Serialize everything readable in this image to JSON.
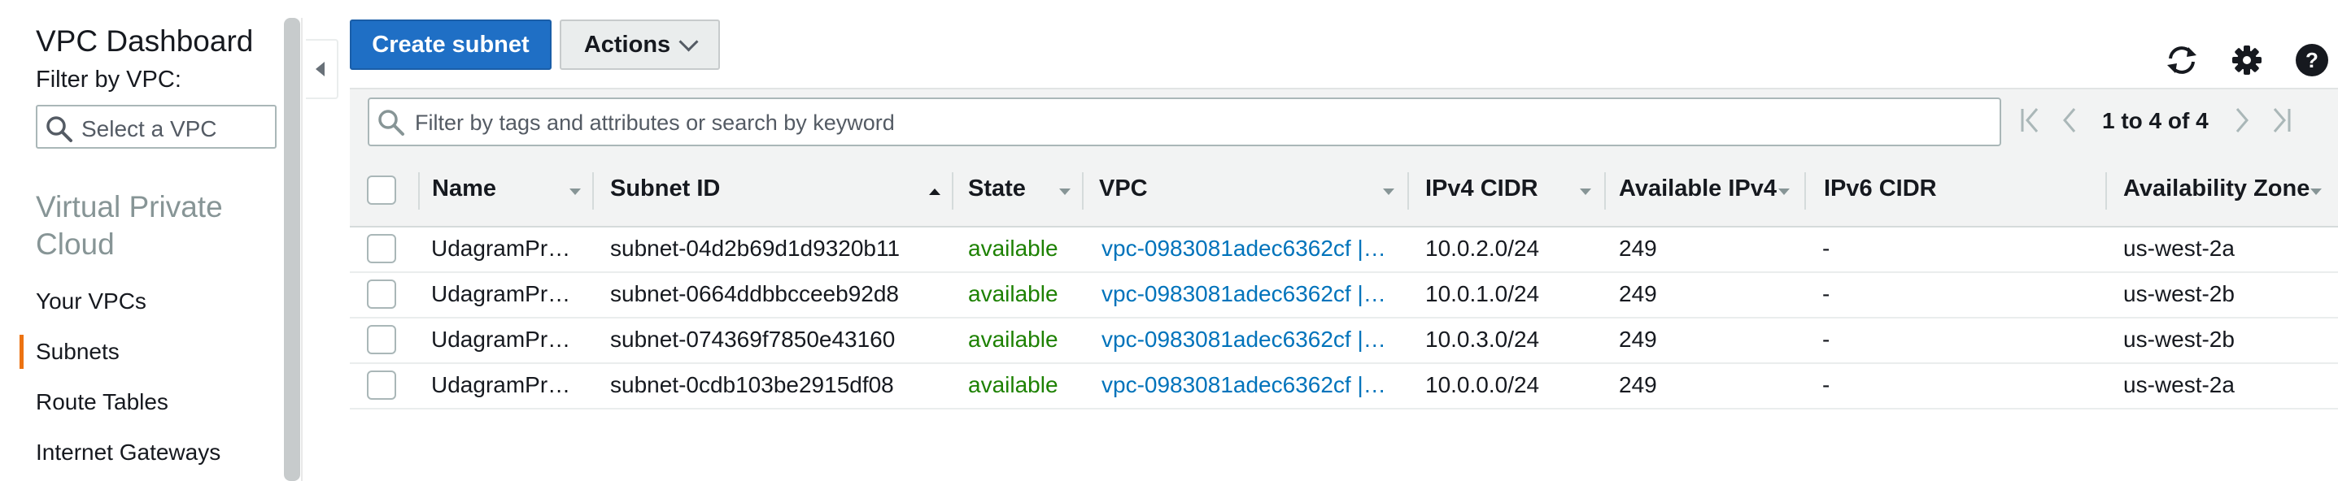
{
  "sidebar": {
    "title": "VPC Dashboard",
    "filter_label": "Filter by VPC:",
    "select_placeholder": "Select a VPC",
    "section_title": "Virtual Private Cloud",
    "links": [
      {
        "label": "Your VPCs",
        "active": false
      },
      {
        "label": "Subnets",
        "active": true
      },
      {
        "label": "Route Tables",
        "active": false
      },
      {
        "label": "Internet Gateways",
        "active": false
      }
    ]
  },
  "toolbar": {
    "create_label": "Create subnet",
    "actions_label": "Actions"
  },
  "filter": {
    "placeholder": "Filter by tags and attributes or search by keyword",
    "pagination": "1 to 4 of 4"
  },
  "table": {
    "columns": [
      "Name",
      "Subnet ID",
      "State",
      "VPC",
      "IPv4 CIDR",
      "Available IPv4",
      "IPv6 CIDR",
      "Availability Zone"
    ],
    "rows": [
      {
        "name": "UdagramPr…",
        "subnet_id": "subnet-04d2b69d1d9320b11",
        "state": "available",
        "vpc": "vpc-0983081adec6362cf |…",
        "ipv4_cidr": "10.0.2.0/24",
        "available_ipv4": "249",
        "ipv6_cidr": "-",
        "az": "us-west-2a"
      },
      {
        "name": "UdagramPr…",
        "subnet_id": "subnet-0664ddbbcceeb92d8",
        "state": "available",
        "vpc": "vpc-0983081adec6362cf |…",
        "ipv4_cidr": "10.0.1.0/24",
        "available_ipv4": "249",
        "ipv6_cidr": "-",
        "az": "us-west-2b"
      },
      {
        "name": "UdagramPr…",
        "subnet_id": "subnet-074369f7850e43160",
        "state": "available",
        "vpc": "vpc-0983081adec6362cf |…",
        "ipv4_cidr": "10.0.3.0/24",
        "available_ipv4": "249",
        "ipv6_cidr": "-",
        "az": "us-west-2b"
      },
      {
        "name": "UdagramPr…",
        "subnet_id": "subnet-0cdb103be2915df08",
        "state": "available",
        "vpc": "vpc-0983081adec6362cf |…",
        "ipv4_cidr": "10.0.0.0/24",
        "available_ipv4": "249",
        "ipv6_cidr": "-",
        "az": "us-west-2a"
      }
    ]
  },
  "icons": {
    "refresh": "refresh-icon",
    "settings": "gear-icon",
    "help": "help-icon",
    "search": "search-icon"
  },
  "colors": {
    "primary": "#1f6fc5",
    "active_nav": "#ec7211",
    "state_available": "#1d8102",
    "link": "#0073bb"
  }
}
